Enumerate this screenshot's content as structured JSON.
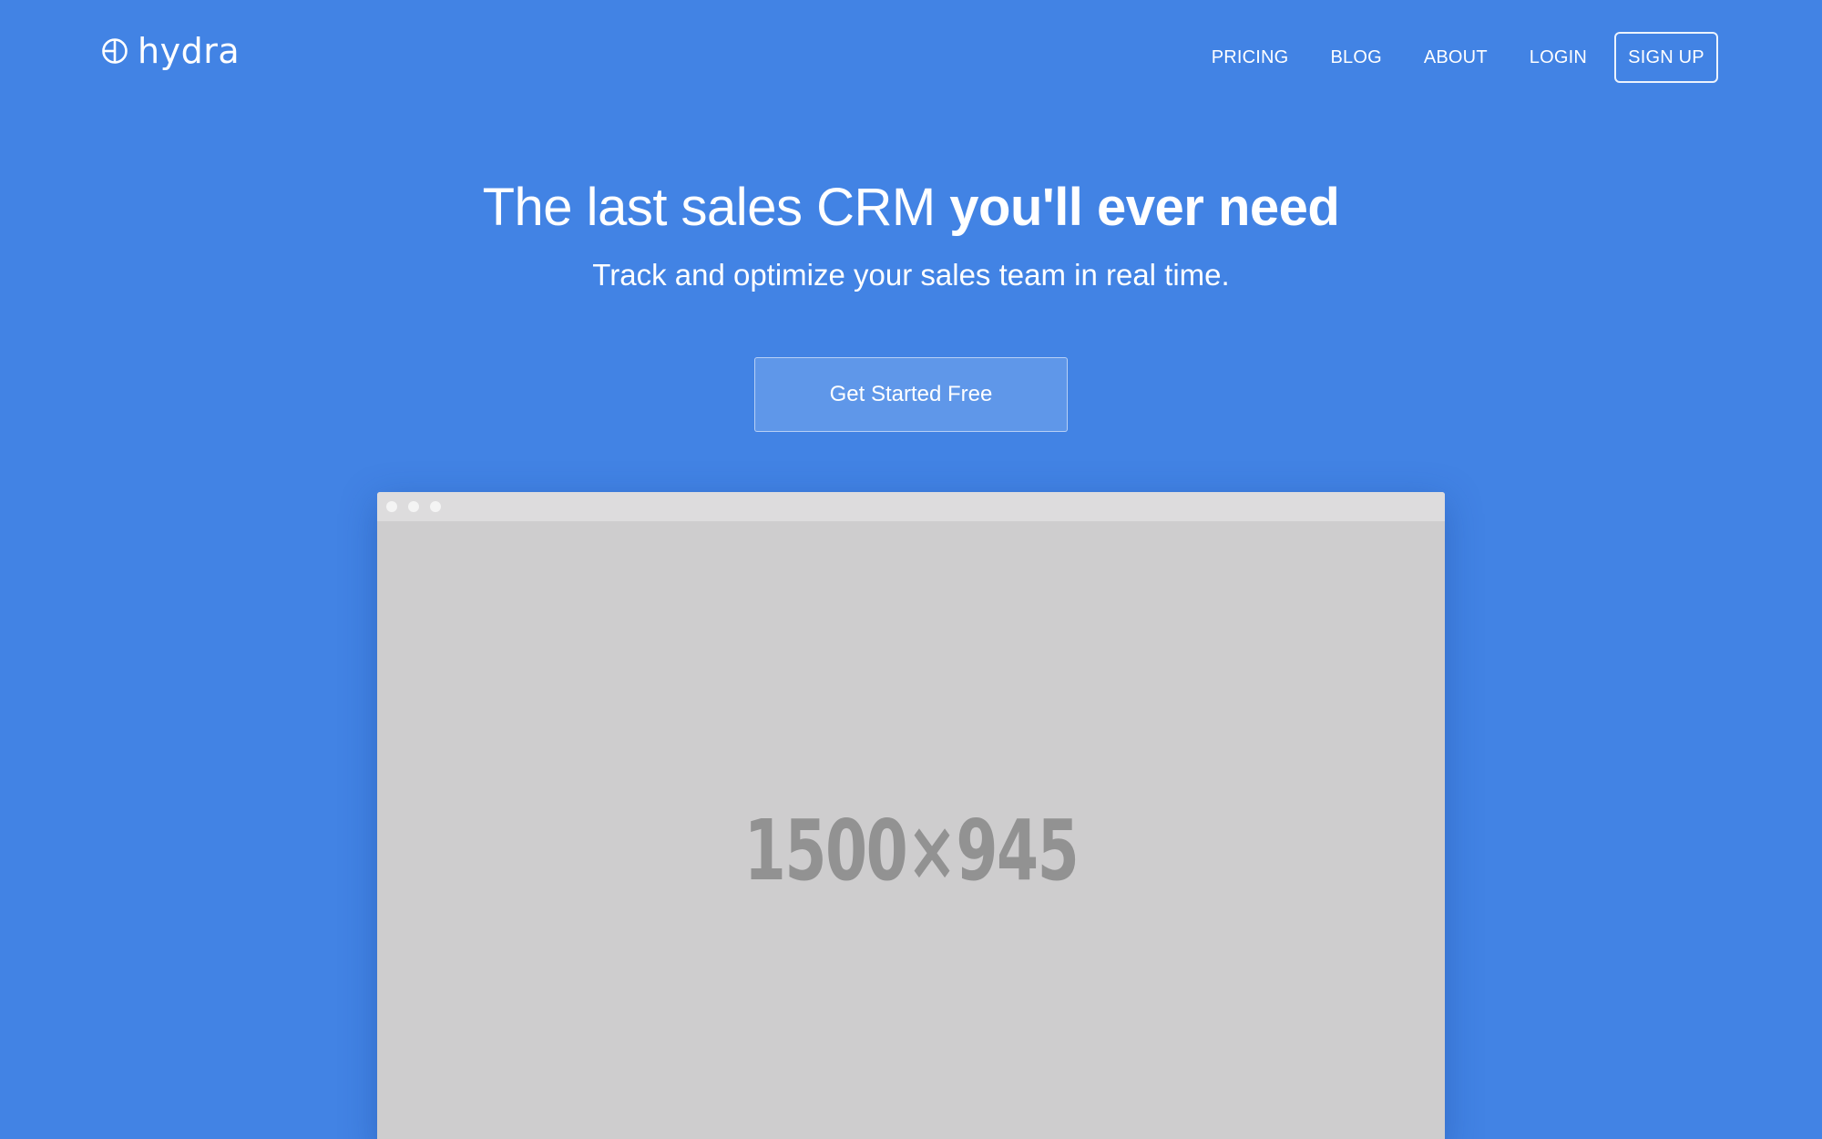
{
  "brand": {
    "name": "hydra",
    "icon": "globe-circle-icon"
  },
  "nav": {
    "items": [
      {
        "label": "PRICING"
      },
      {
        "label": "BLOG"
      },
      {
        "label": "ABOUT"
      },
      {
        "label": "LOGIN"
      }
    ],
    "signup_label": "SIGN UP"
  },
  "hero": {
    "title_regular": "The last sales CRM ",
    "title_bold": "you'll ever need",
    "subtitle": "Track and optimize your sales team in real time.",
    "cta_label": "Get Started Free"
  },
  "mockup": {
    "placeholder_label": "1500×945"
  },
  "colors": {
    "background": "#4283e4",
    "cta_background": "#5f97e9",
    "mockup_body": "#cecdce",
    "mockup_bar": "#dddcdd"
  }
}
